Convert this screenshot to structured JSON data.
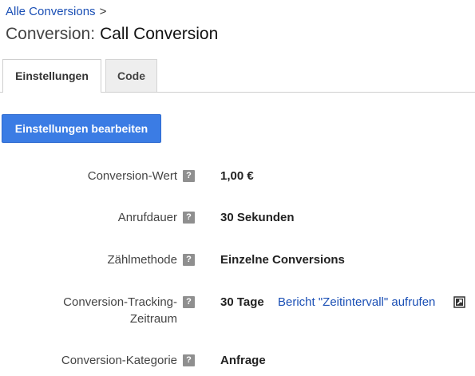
{
  "breadcrumb": {
    "link_label": "Alle Conversions",
    "separator": ">"
  },
  "page": {
    "title_prefix": "Conversion:",
    "title_name": "Call Conversion"
  },
  "tabs": [
    {
      "label": "Einstellungen",
      "active": true
    },
    {
      "label": "Code",
      "active": false
    }
  ],
  "actions": {
    "edit_settings_label": "Einstellungen bearbeiten"
  },
  "settings": [
    {
      "label": "Conversion-Wert",
      "value": "1,00 €"
    },
    {
      "label": "Anrufdauer",
      "value": "30 Sekunden"
    },
    {
      "label": "Zählmethode",
      "value": "Einzelne Conversions"
    },
    {
      "label_line1": "Conversion-Tracking-",
      "label_line2": "Zeitraum",
      "value": "30 Tage",
      "link_label": "Bericht \"Zeitintervall\" aufrufen"
    },
    {
      "label": "Conversion-Kategorie",
      "value": "Anfrage"
    }
  ],
  "icons": {
    "help": "help-icon",
    "external_link": "external-link-icon"
  },
  "colors": {
    "link": "#1a4fb5",
    "primary_button": "#3b7ce4",
    "help_icon": "#8f8f8f"
  }
}
